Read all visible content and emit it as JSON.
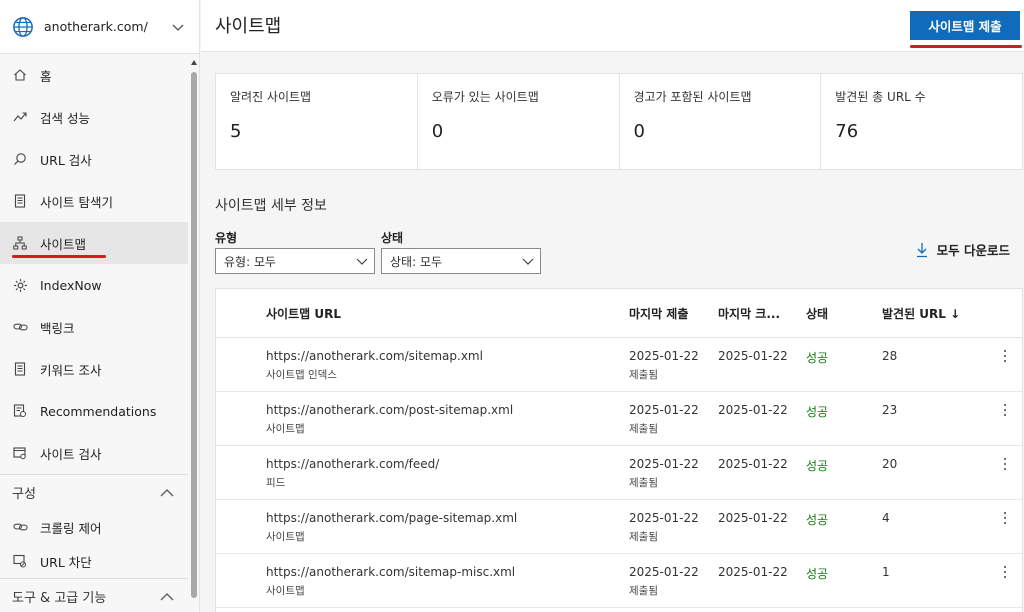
{
  "site": {
    "name": "anotherark.com/"
  },
  "sidebar": {
    "items": [
      {
        "label": "홈",
        "icon": "home-icon"
      },
      {
        "label": "검색 성능",
        "icon": "trend-icon"
      },
      {
        "label": "URL 검사",
        "icon": "search-icon"
      },
      {
        "label": "사이트 탐색기",
        "icon": "document-icon"
      },
      {
        "label": "사이트맵",
        "icon": "sitemap-icon",
        "active": true
      },
      {
        "label": "IndexNow",
        "icon": "gear-icon"
      },
      {
        "label": "백링크",
        "icon": "link-icon"
      },
      {
        "label": "키워드 조사",
        "icon": "document-icon"
      },
      {
        "label": "Recommendations",
        "icon": "recommend-icon"
      },
      {
        "label": "사이트 검사",
        "icon": "scan-icon"
      }
    ],
    "section_config": "구성",
    "config_items": [
      {
        "label": "크롤링 제어",
        "icon": "link-icon"
      },
      {
        "label": "URL 차단",
        "icon": "block-icon"
      }
    ],
    "section_tools": "도구 & 고급 기능"
  },
  "header": {
    "title": "사이트맵",
    "submit_label": "사이트맵 제출"
  },
  "stats": [
    {
      "label": "알려진 사이트맵",
      "value": "5"
    },
    {
      "label": "오류가 있는 사이트맵",
      "value": "0"
    },
    {
      "label": "경고가 포함된 사이트맵",
      "value": "0"
    },
    {
      "label": "발견된 총 URL 수",
      "value": "76"
    }
  ],
  "details": {
    "title": "사이트맵 세부 정보",
    "type_label": "유형",
    "type_value": "유형: 모두",
    "status_label": "상태",
    "status_value": "상태: 모두",
    "download_label": "모두 다운로드"
  },
  "table": {
    "columns": {
      "url": "사이트맵 URL",
      "submitted": "마지막 제출",
      "crawled": "마지막 크...",
      "status": "상태",
      "count": "발견된 URL ↓"
    },
    "rows": [
      {
        "url": "https://anotherark.com/sitemap.xml",
        "type": "사이트맵 인덱스",
        "submitted": "2025-01-22",
        "submitted_note": "제출됨",
        "crawled": "2025-01-22",
        "status": "성공",
        "count": "28"
      },
      {
        "url": "https://anotherark.com/post-sitemap.xml",
        "type": "사이트맵",
        "submitted": "2025-01-22",
        "submitted_note": "제출됨",
        "crawled": "2025-01-22",
        "status": "성공",
        "count": "23"
      },
      {
        "url": "https://anotherark.com/feed/",
        "type": "피드",
        "submitted": "2025-01-22",
        "submitted_note": "제출됨",
        "crawled": "2025-01-22",
        "status": "성공",
        "count": "20"
      },
      {
        "url": "https://anotherark.com/page-sitemap.xml",
        "type": "사이트맵",
        "submitted": "2025-01-22",
        "submitted_note": "제출됨",
        "crawled": "2025-01-22",
        "status": "성공",
        "count": "4"
      },
      {
        "url": "https://anotherark.com/sitemap-misc.xml",
        "type": "사이트맵",
        "submitted": "2025-01-22",
        "submitted_note": "제출됨",
        "crawled": "2025-01-22",
        "status": "성공",
        "count": "1"
      }
    ]
  },
  "colors": {
    "accent": "#0f6cbd",
    "highlight": "#d71920",
    "success": "#107c10"
  }
}
